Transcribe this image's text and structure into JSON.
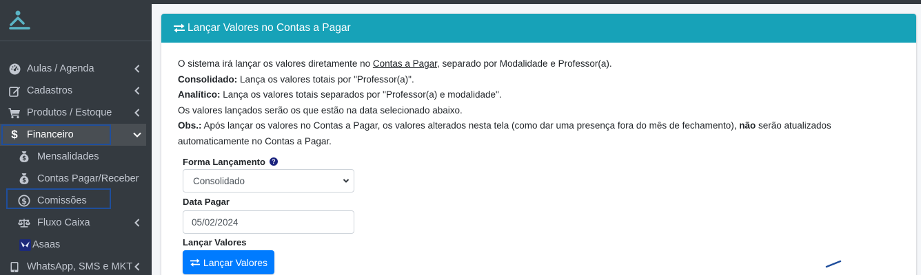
{
  "sidebar": {
    "items": [
      {
        "label": "Aulas / Agenda",
        "icon": "gauge-icon"
      },
      {
        "label": "Cadastros",
        "icon": "edit-icon"
      },
      {
        "label": "Produtos / Estoque",
        "icon": "cart-icon"
      },
      {
        "label": "Financeiro",
        "icon": "dollar-icon"
      },
      {
        "label": "Mensalidades",
        "icon": "money-bag-icon"
      },
      {
        "label": "Contas Pagar/Receber",
        "icon": "money-bag-icon"
      },
      {
        "label": "Comissões",
        "icon": "dollar-circle-icon"
      },
      {
        "label": "Fluxo Caixa",
        "icon": "balance-scale-icon"
      },
      {
        "label": "Asaas",
        "icon": "asaas-logo-icon"
      },
      {
        "label": "WhatsApp, SMS e MKT",
        "icon": "mobile-icon"
      }
    ]
  },
  "card": {
    "title": "Lançar Valores no Contas a Pagar",
    "line1_pre": "O sistema irá lançar os valores diretamente no ",
    "line1_link": "Contas a Pagar",
    "line1_post": ", separado por Modalidade e Professor(a).",
    "line2_bold": "Consolidado:",
    "line2_text": " Lança os valores totais por \"Professor(a)\".",
    "line3_bold": "Analítico:",
    "line3_text": " Lança os valores totais separados por \"Professor(a) e modalidade\".",
    "line4": "Os valores lançados serão os que estão na data selecionado abaixo.",
    "line5_bold": "Obs.:",
    "line5_pre": " Após lançar os valores no Contas a Pagar, os valores alterados nesta tela (como dar uma presença fora do mês de fechamento), ",
    "line5_bold2": "não",
    "line5_post": " serão atualizados automaticamente no Contas a Pagar."
  },
  "form": {
    "forma_label": "Forma Lançamento",
    "forma_value": "Consolidado",
    "data_label": "Data Pagar",
    "data_value": "05/02/2024",
    "lancar_label": "Lançar Valores",
    "button_label": "Lançar Valores"
  },
  "colors": {
    "sidebar_bg": "#343a40",
    "header_bg": "#17a2b8",
    "primary": "#007bff",
    "highlight_box": "#1f4e9c"
  }
}
